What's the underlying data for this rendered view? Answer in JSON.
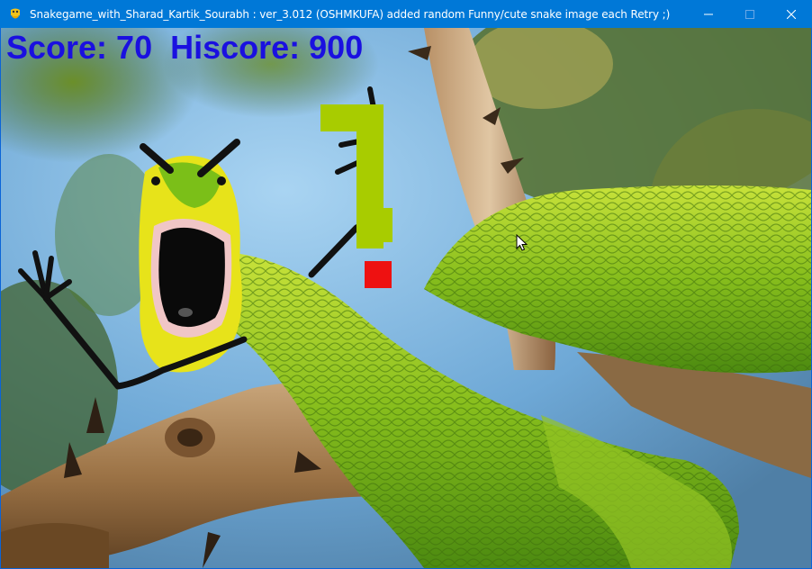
{
  "window": {
    "title": "Snakegame_with_Sharad_Kartik_Sourabh :  ver_3.012 (OSHMKUFA) added random Funny/cute snake image each Retry ;)",
    "app_icon": "python-pygame-icon",
    "controls": [
      "minimize-icon",
      "maximize-icon",
      "close-icon"
    ]
  },
  "hud": {
    "score_label": "Score: 70  Hiscore: 900",
    "score": 70,
    "hiscore": 900,
    "color": "#1a10e0"
  },
  "game": {
    "snake_color": "#a8cc00",
    "food_color": "#ee1111",
    "background_image": "funny green snake with drawn arms on branch"
  }
}
